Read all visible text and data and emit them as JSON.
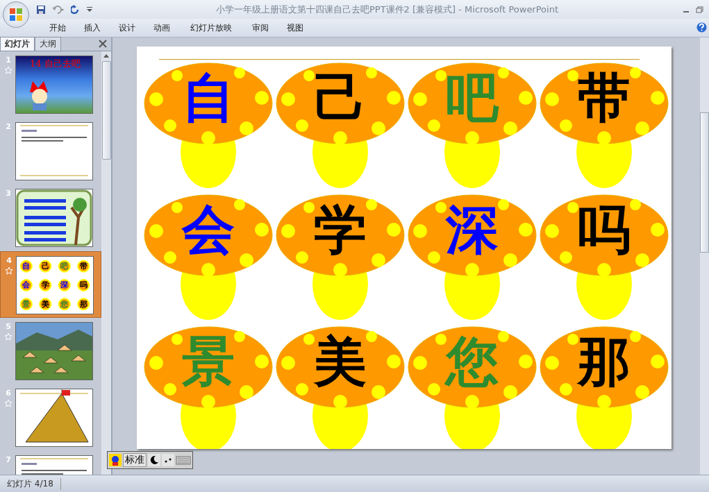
{
  "window": {
    "title": "小学一年级上册语文第十四课自己去吧PPT课件2 [兼容模式] - Microsoft PowerPoint"
  },
  "ribbon_tabs": [
    {
      "label": "开始"
    },
    {
      "label": "插入"
    },
    {
      "label": "设计"
    },
    {
      "label": "动画"
    },
    {
      "label": "幻灯片放映"
    },
    {
      "label": "审阅"
    },
    {
      "label": "视图"
    }
  ],
  "pane_tabs": [
    {
      "label": "幻灯片",
      "selected": true
    },
    {
      "label": "大纲",
      "selected": false
    }
  ],
  "slides": [
    {
      "number": "1",
      "kind": "title",
      "title": "14 自己去吧",
      "animated": true,
      "selected": false
    },
    {
      "number": "2",
      "kind": "text",
      "animated": false,
      "selected": false
    },
    {
      "number": "3",
      "kind": "pinyin",
      "animated": false,
      "selected": false
    },
    {
      "number": "4",
      "kind": "mushrooms",
      "animated": true,
      "selected": true,
      "characters": [
        "自",
        "己",
        "吧",
        "带",
        "会",
        "学",
        "深",
        "吗",
        "景",
        "美",
        "您",
        "那"
      ]
    },
    {
      "number": "5",
      "kind": "photo",
      "animated": true,
      "selected": false
    },
    {
      "number": "6",
      "kind": "pyramid",
      "animated": true,
      "selected": false
    },
    {
      "number": "7",
      "kind": "text",
      "animated": false,
      "selected": false
    }
  ],
  "slide": {
    "mushrooms": [
      {
        "character": "自",
        "color": "#0000ff"
      },
      {
        "character": "己",
        "color": "#000000"
      },
      {
        "character": "吧",
        "color": "#2e8b2e"
      },
      {
        "character": "带",
        "color": "#000000"
      },
      {
        "character": "会",
        "color": "#0000ff"
      },
      {
        "character": "学",
        "color": "#000000"
      },
      {
        "character": "深",
        "color": "#0000ff"
      },
      {
        "character": "吗",
        "color": "#000000"
      },
      {
        "character": "景",
        "color": "#2e8b2e"
      },
      {
        "character": "美",
        "color": "#000000"
      },
      {
        "character": "您",
        "color": "#2e8b2e"
      },
      {
        "character": "那",
        "color": "#000000"
      }
    ]
  },
  "ime_toolbar": {
    "mode": "标准"
  },
  "status_bar": {
    "slide_counter": "幻灯片 4/18"
  }
}
